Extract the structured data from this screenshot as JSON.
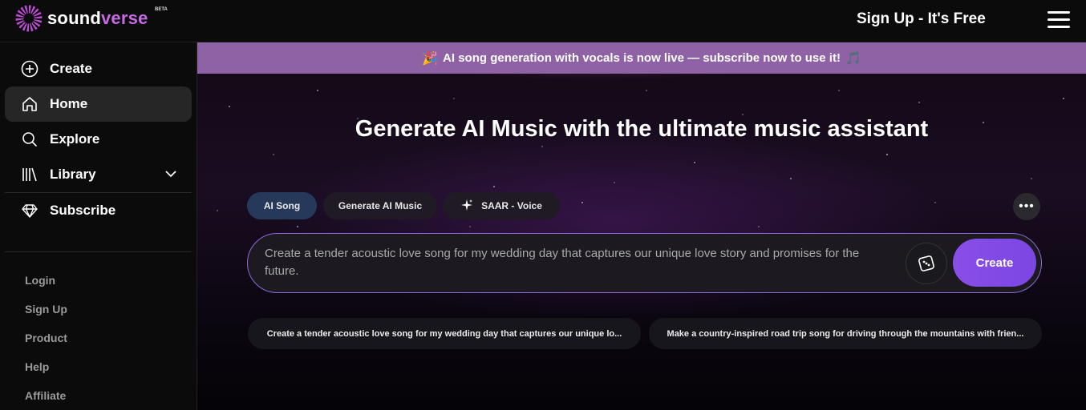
{
  "header": {
    "logo_part1": "sound",
    "logo_part2": "verse",
    "beta": "BETA",
    "signup": "Sign Up - It's Free",
    "menu_icon": "hamburger-icon"
  },
  "sidebar": {
    "items": [
      {
        "label": "Create",
        "icon": "plus-circle-icon"
      },
      {
        "label": "Home",
        "icon": "home-icon"
      },
      {
        "label": "Explore",
        "icon": "search-icon"
      },
      {
        "label": "Library",
        "icon": "library-icon"
      },
      {
        "label": "Subscribe",
        "icon": "diamond-icon"
      }
    ],
    "footer_links": [
      "Login",
      "Sign Up",
      "Product",
      "Help",
      "Affiliate"
    ]
  },
  "banner": {
    "text": "AI song generation with vocals is now live — subscribe now to use it!",
    "left_emoji": "🎉",
    "right_emoji": "🎵"
  },
  "hero": {
    "title": "Generate AI Music with the ultimate music assistant"
  },
  "tabs": [
    {
      "label": "AI Song",
      "active": true
    },
    {
      "label": "Generate AI Music",
      "active": false
    },
    {
      "label": "SAAR - Voice",
      "active": false
    }
  ],
  "more_button": "•••",
  "prompt": {
    "text": "Create a tender acoustic love song for my wedding day that captures our unique love story and promises for the future.",
    "create_label": "Create"
  },
  "suggestions": [
    "Create a tender acoustic love song for my wedding day that captures our unique lo...",
    "Make a country-inspired road trip song for driving through the mountains with frien..."
  ],
  "colors": {
    "accent": "#8a4ee6",
    "banner": "#8f62a6",
    "active_chip": "#27395a"
  }
}
